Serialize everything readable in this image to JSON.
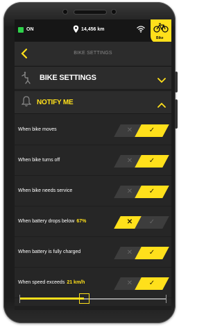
{
  "status": {
    "power": "ON",
    "distance": "14,456 km",
    "bike_label": "Bike"
  },
  "header": {
    "title": "BIKE SETTINGS"
  },
  "sections": {
    "bike_settings": "BIKE SETTINGS",
    "notify_me": "NOTIFY ME"
  },
  "notifications": [
    {
      "label": "When bike moves",
      "value": "",
      "enabled": true
    },
    {
      "label": "When bike turns off",
      "value": "",
      "enabled": true
    },
    {
      "label": "When bike needs service",
      "value": "",
      "enabled": true
    },
    {
      "label": "When battery drops below",
      "value": "67%",
      "enabled": false
    },
    {
      "label": "When battery is fully charged",
      "value": "",
      "enabled": true
    },
    {
      "label": "When speed exceeds",
      "value": "21 km/h",
      "enabled": true
    }
  ],
  "speed_slider": {
    "level": 0.44
  },
  "colors": {
    "accent": "#ffe01b",
    "status_on": "#2ed14a",
    "background": "#262626"
  },
  "icons": {
    "back": "chevron-left-icon",
    "bike_settings": "bike-settings-icon",
    "notify": "bell-icon",
    "bike": "bike-icon",
    "location": "pin-icon",
    "wifi": "wifi-icon"
  }
}
